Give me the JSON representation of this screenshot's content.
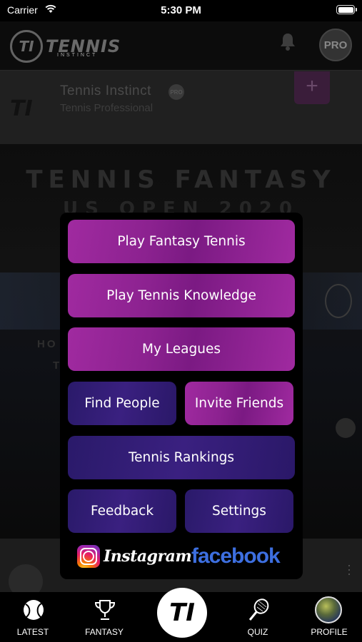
{
  "status_bar": {
    "carrier": "Carrier",
    "time": "5:30 PM",
    "battery_level": 1.0
  },
  "header": {
    "logo_mark": "TI",
    "logo_text": "TENNIS",
    "logo_sub": "INSTINCT",
    "pro_badge": "PRO",
    "icons": [
      "bell-icon"
    ]
  },
  "profile_card": {
    "logo_mark": "TI",
    "name": "Tennis Instinct",
    "badge": "PRO",
    "role": "Tennis Professional",
    "add_label": "+"
  },
  "banner": {
    "title": "TENNIS FANTASY",
    "subtitle": "US OPEN 2020",
    "side_text": "HO",
    "side_text_2": "T"
  },
  "menu": {
    "play_fantasy": "Play Fantasy Tennis",
    "play_knowledge": "Play Tennis Knowledge",
    "my_leagues": "My Leagues",
    "find_people": "Find People",
    "invite_friends": "Invite Friends",
    "rankings": "Tennis Rankings",
    "feedback": "Feedback",
    "settings": "Settings",
    "instagram": "Instagram",
    "facebook": "facebook"
  },
  "colors": {
    "magenta": "#9a259c",
    "indigo": "#30207a",
    "facebook_blue": "#3d6fe0"
  },
  "tabbar": {
    "latest": "LATEST",
    "fantasy": "FANTASY",
    "center": "TI",
    "quiz": "QUIZ",
    "profile": "PROFILE"
  }
}
